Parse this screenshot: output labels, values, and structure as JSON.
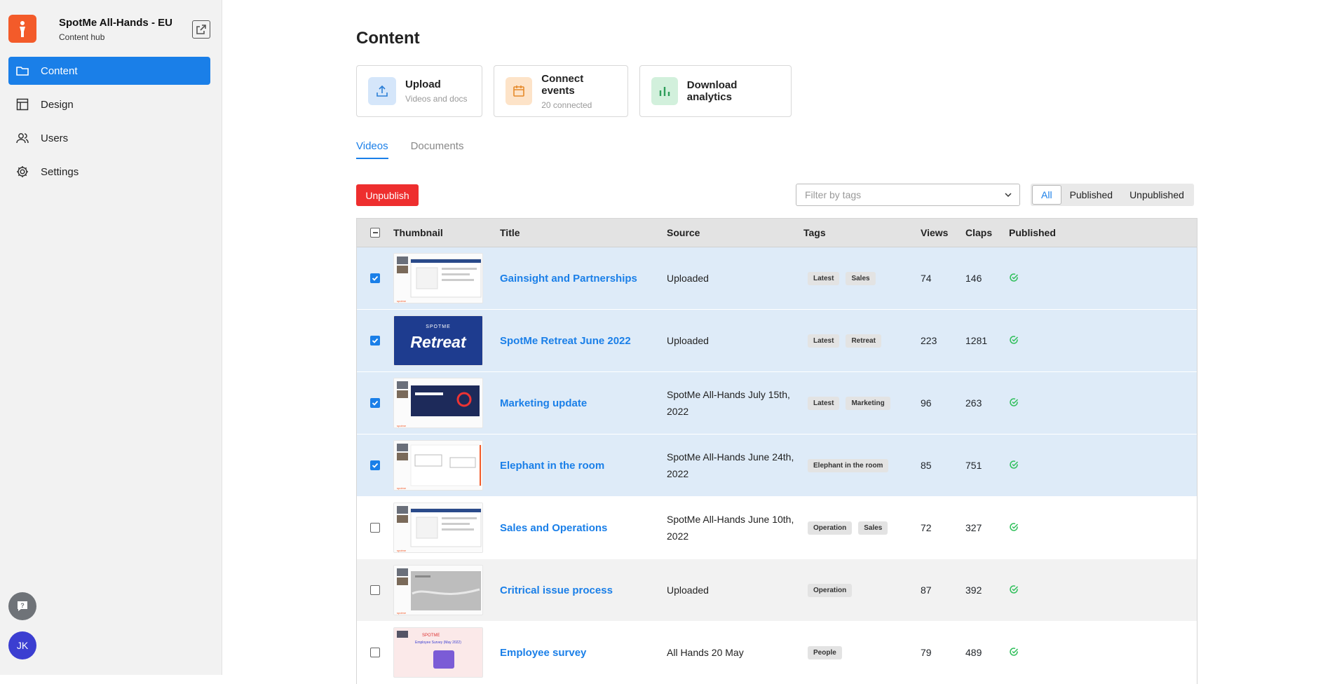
{
  "app": {
    "title": "SpotMe All-Hands - EU",
    "subtitle": "Content hub"
  },
  "nav": [
    {
      "label": "Content",
      "icon": "folder-icon",
      "active": true
    },
    {
      "label": "Design",
      "icon": "layout-icon",
      "active": false
    },
    {
      "label": "Users",
      "icon": "users-icon",
      "active": false
    },
    {
      "label": "Settings",
      "icon": "gear-icon",
      "active": false
    }
  ],
  "user": {
    "initials": "JK"
  },
  "page": {
    "title": "Content"
  },
  "actions": {
    "upload": {
      "title": "Upload",
      "subtitle": "Videos and docs"
    },
    "connect": {
      "title": "Connect events",
      "subtitle": "20 connected"
    },
    "analytics": {
      "title": "Download analytics"
    }
  },
  "tabs": {
    "videos": "Videos",
    "documents": "Documents"
  },
  "toolbar": {
    "unpublish": "Unpublish",
    "tag_filter_placeholder": "Filter by tags",
    "filters": {
      "all": "All",
      "published": "Published",
      "unpublished": "Unpublished"
    }
  },
  "table": {
    "headers": {
      "thumbnail": "Thumbnail",
      "title": "Title",
      "source": "Source",
      "tags": "Tags",
      "views": "Views",
      "claps": "Claps",
      "published": "Published"
    },
    "rows": [
      {
        "checked": true,
        "title": "Gainsight and Partnerships",
        "source": "Uploaded",
        "tags": [
          "Latest",
          "Sales"
        ],
        "views": "74",
        "claps": "146",
        "published": true,
        "thumb": "slide"
      },
      {
        "checked": true,
        "title": "SpotMe Retreat June 2022",
        "source": "Uploaded",
        "tags": [
          "Latest",
          "Retreat"
        ],
        "views": "223",
        "claps": "1281",
        "published": true,
        "thumb": "retreat",
        "thumb_text": {
          "top": "SPOTME",
          "main": "Retreat"
        }
      },
      {
        "checked": true,
        "title": "Marketing update",
        "source": "SpotMe All-Hands July 15th, 2022",
        "tags": [
          "Latest",
          "Marketing"
        ],
        "views": "96",
        "claps": "263",
        "published": true,
        "thumb": "dark"
      },
      {
        "checked": true,
        "title": "Elephant in the room",
        "source": "SpotMe All-Hands June 24th, 2022",
        "tags": [
          "Elephant in the room"
        ],
        "views": "85",
        "claps": "751",
        "published": true,
        "thumb": "slide2"
      },
      {
        "checked": false,
        "title": "Sales and Operations",
        "source": "SpotMe All-Hands June 10th, 2022",
        "tags": [
          "Operation",
          "Sales"
        ],
        "views": "72",
        "claps": "327",
        "published": true,
        "thumb": "slide"
      },
      {
        "checked": false,
        "title": "Critrical issue process",
        "source": "Uploaded",
        "tags": [
          "Operation"
        ],
        "views": "87",
        "claps": "392",
        "published": true,
        "thumb": "grey"
      },
      {
        "checked": false,
        "title": "Employee survey",
        "source": "All Hands 20 May",
        "tags": [
          "People"
        ],
        "views": "79",
        "claps": "489",
        "published": true,
        "thumb": "survey",
        "thumb_text": {
          "top": "SPOTME",
          "main": "Employee Survey (May 2022)"
        }
      }
    ]
  },
  "colors": {
    "accent": "#1a7fe8",
    "danger": "#ee2e2e",
    "brand": "#f35b2a",
    "success": "#2fbf5a",
    "selected_row": "#deebf8"
  }
}
